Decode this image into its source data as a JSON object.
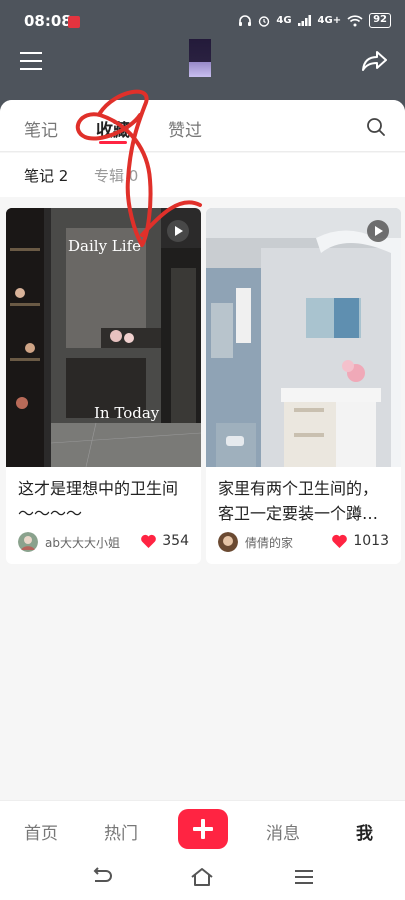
{
  "status_bar": {
    "time": "08:08",
    "network": "4G",
    "network2": "4G+",
    "battery": "92"
  },
  "tabs": [
    {
      "label": "笔记"
    },
    {
      "label": "收藏"
    },
    {
      "label": "赞过"
    }
  ],
  "subtabs": [
    {
      "label": "笔记 2"
    },
    {
      "label": "专辑 0"
    }
  ],
  "cards": [
    {
      "title": "这才是理想中的卫生间～～～～",
      "author": "ab大大大小姐",
      "likes": "354",
      "image_text_top": "Daily Life",
      "image_text_bottom": "In Today"
    },
    {
      "title": "家里有两个卫生间的，客卫一定要装一个蹲…",
      "author": "倩倩的家",
      "likes": "1013"
    }
  ],
  "bottom_nav": [
    {
      "label": "首页"
    },
    {
      "label": "热门"
    },
    {
      "label": "消息"
    },
    {
      "label": "我"
    }
  ],
  "colors": {
    "accent": "#ff2442",
    "header_bg": "#4e545c",
    "annotation": "#e0302a"
  }
}
